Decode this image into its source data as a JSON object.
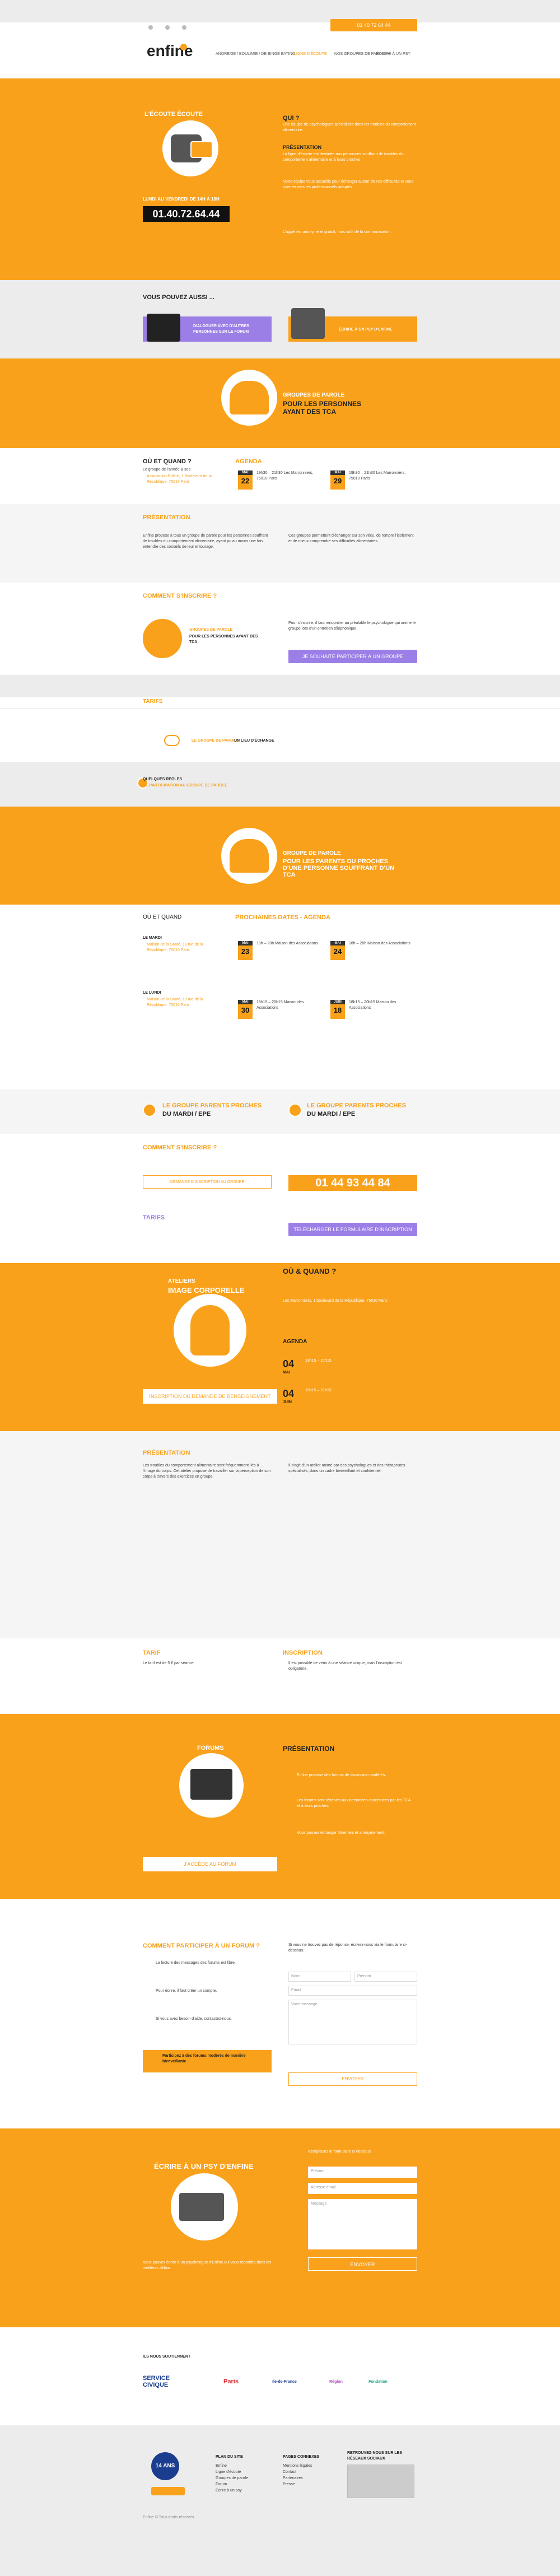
{
  "topbar": {
    "phone_btn": "01 40 72 64 44"
  },
  "nav": {
    "logo": "enfine",
    "items": [
      "ANOREXIE / BOULIMIE / DE BINGE EATING",
      "LIGNE D'ÉCOUTE",
      "NOS GROUPES DE PAROLE ▾",
      "ÉCRIRE À UN PSY"
    ]
  },
  "hero": {
    "left_title": "L'ÉCOUTE ÉCOUTE",
    "hours": "LUNDI AU VENDREDI DE 14H À 18H",
    "phone": "01.40.72.64.44",
    "qui_title": "QUI ?",
    "qui_text": "Une équipe de psychologues spécialisés dans les troubles du comportement alimentaire.",
    "pres_title": "PRÉSENTATION",
    "pres_p1": "La ligne d'écoute est destinée aux personnes souffrant de troubles du comportement alimentaire et à leurs proches.",
    "pres_p2": "Notre équipe vous accueille pour échanger autour de vos difficultés et vous orienter vers les professionnels adaptés.",
    "pres_p3": "L'appel est anonyme et gratuit, hors coût de la communication."
  },
  "youcan": {
    "title": "VOUS POUVEZ AUSSI ...",
    "btn1": "DIALOGUER AVEC D'AUTRES PERSONNES SUR LE FORUM",
    "btn2": "ÉCRIRE À UN PSY D'ENFINE"
  },
  "tca": {
    "title1": "GROUPES DE PAROLE",
    "title2": "POUR LES PERSONNES AYANT DES TCA",
    "where_title": "OÙ ET QUAND ?",
    "where_sub": "Le groupe de l'année & ses",
    "where_text": "Association Enfine, 1 Boulevard de la République, 75010 Paris",
    "agenda_title": "AGENDA",
    "d1_day": "22",
    "d1_mon": "MAI",
    "d1_text": "19h30 – 21h30 Les Marronniers, 75010 Paris",
    "d2_day": "29",
    "d2_mon": "MAI",
    "d2_text": "19h30 – 21h30 Les Marronniers, 75010 Paris",
    "pres_title": "PRÉSENTATION",
    "pres_left": "Enfine propose à tous un groupe de parole pour les personnes souffrant de troubles du comportement alimentaire, ayant pu au moins une fois entendre des conseils de leur entourage.",
    "pres_right": "Ces groupes permettent d'échanger sur son vécu, de rompre l'isolement et de mieux comprendre ses difficultés alimentaires.",
    "how_title": "COMMENT S'INSCRIRE ?",
    "how_label1": "GROUPES DE PAROLE",
    "how_label2": "POUR LES PERSONNES AYANT DES TCA",
    "how_text": "Pour s'inscrire, il faut rencontrer au préalable le psychologue qui anime le groupe lors d'un entretien téléphonique.",
    "how_btn": "JE SOUHAITE PARTICIPER À UN GROUPE"
  },
  "tarifs": {
    "title": "TARIFS",
    "line1": "LE GROUPE DE PAROLE",
    "line1b": "UN LIEU D'ÉCHANGE",
    "q_title": "QUELQUES REGLES",
    "q_sub": "DE PARTICIPATION AU GROUPE DE PAROLE"
  },
  "parents": {
    "title1": "GROUPE DE PAROLE",
    "title2": "POUR LES PARENTS OU PROCHES D'UNE PERSONNE SOUFFRANT D'UN TCA",
    "where_title": "OÙ ET QUAND",
    "mardi": "LE MARDI",
    "mardi_text": "Maison de la Santé, 10 rue de la République, 75010 Paris",
    "lundi": "LE LUNDI",
    "lundi_text": "Maison de la Santé, 10 rue de la République, 75010 Paris",
    "agenda_title": "PROCHAINES DATES - AGENDA",
    "dates": [
      {
        "d": "23",
        "m": "MAI",
        "t": "18h – 20h Maison des Associations"
      },
      {
        "d": "24",
        "m": "MAI",
        "t": "18h – 20h Maison des Associations"
      },
      {
        "d": "30",
        "m": "MAI",
        "t": "18h15 – 20h15 Maison des Associations"
      },
      {
        "d": "18",
        "m": "JUIN",
        "t": "18h15 – 20h15 Maison des Associations"
      }
    ],
    "block1": "LE GROUPE PARENTS PROCHES",
    "block1b": "DU MARDI / EPE",
    "block2": "LE GROUPE PARENTS PROCHES",
    "block2b": "DU MARDI / EPE",
    "how_title": "COMMENT S'INSCRIRE ?",
    "how_btn": "DEMANDE D'INSCRIPTION AU GROUPE",
    "phone": "01 44 93 44 84",
    "tarif_title": "TARIFS",
    "tarif_btn": "TÉLÉCHARGER LE FORMULAIRE D'INSCRIPTION"
  },
  "atelier": {
    "title": "ATELIERS",
    "sub": "IMAGE CORPORELLE",
    "where_title": "OÙ & QUAND ?",
    "where_text": "Les Marronniers, 1 boulevard de la République, 75010 Paris",
    "agenda_title": "AGENDA",
    "d1": "04",
    "d1m": "MAI",
    "d1t": "19h15 – 21h15",
    "d2": "04",
    "d2m": "JUIN",
    "d2t": "19h15 – 21h15",
    "btn": "INSCRIPTION DU DEMANDE DE RENSEIGNEMENT"
  },
  "atelier_pres": {
    "title": "PRÉSENTATION",
    "left": "Les troubles du comportement alimentaire sont fréquemment liés à l'image du corps. Cet atelier propose de travailler sur la perception de son corps à travers des exercices en groupe.",
    "right": "Il s'agit d'un atelier animé par des psychologues et des thérapeutes spécialisés, dans un cadre bienveillant et confidentiel."
  },
  "tarif2": {
    "title": "TARIF",
    "text": "Le tarif est de 5 € par séance.",
    "insc_title": "INSCRIPTION",
    "insc_text": "Il est possible de venir à une séance unique, mais l'inscription est obligatoire."
  },
  "forum": {
    "title": "FORUMS",
    "btn": "J'ACCÈDE AU FORUM",
    "pres_title": "PRÉSENTATION",
    "items": [
      "Enfine propose des forums de discussion modérés.",
      "Les forums sont réservés aux personnes concernées par les TCA et à leurs proches.",
      "Vous pouvez échanger librement et anonymement."
    ]
  },
  "participate": {
    "title": "COMMENT PARTICIPER À UN FORUM ?",
    "steps": [
      "La lecture des messages des forums est libre.",
      "Pour écrire, il faut créer un compte.",
      "Si vous avez besoin d'aide, contactez-nous."
    ],
    "banner": "Participez à des forums modérés de manière bienveillante",
    "form_text": "Si vous ne trouvez pas de réponse, écrivez-nous via le formulaire ci-dessous.",
    "name": "Nom",
    "firstname": "Prénom",
    "email": "Email",
    "message": "Votre message",
    "send": "ENVOYER"
  },
  "ecrire": {
    "title": "ÉCRIRE À UN PSY D'ENFINE",
    "text": "Vous pouvez écrire à un psychologue d'Enfine qui vous répondra dans les meilleurs délais.",
    "form_label": "Remplissez le formulaire ci-dessous",
    "prenom": "Prénom",
    "email": "Adresse email",
    "message": "Message",
    "send": "ENVOYER"
  },
  "partners": {
    "title": "ILS NOUS SOUTIENNENT",
    "items": [
      "SERVICE CIVIQUE",
      "Paris",
      "Ile-de-France",
      "Région",
      "Fondation"
    ]
  },
  "footer": {
    "badge": "14 ANS",
    "col1_title": "PLAN DU SITE",
    "col1": [
      "Enfine",
      "Ligne d'écoute",
      "Groupes de parole",
      "Forum",
      "Écrire à un psy"
    ],
    "col2_title": "PAGES CONNEXES",
    "col2": [
      "Mentions légales",
      "Contact",
      "Partenaires",
      "Presse"
    ],
    "col3_title": "RETROUVEZ-NOUS SUR LES RÉSEAUX SOCIAUX",
    "copy": "Enfine © Tous droits réservés"
  }
}
